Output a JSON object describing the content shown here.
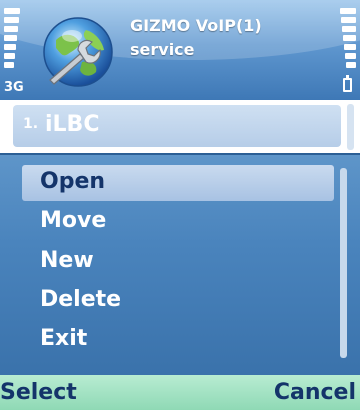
{
  "status_bar": {
    "network_label": "3G"
  },
  "app_header": {
    "title": "GIZMO VoIP(1)",
    "subtitle": "service",
    "icon": "globe-wrench-icon"
  },
  "list": {
    "items": [
      {
        "number": "1.",
        "label": "iLBC"
      }
    ]
  },
  "options_menu": {
    "items": [
      {
        "label": "Open",
        "selected": true
      },
      {
        "label": "Move",
        "selected": false
      },
      {
        "label": "New",
        "selected": false
      },
      {
        "label": "Delete",
        "selected": false
      },
      {
        "label": "Exit",
        "selected": false
      }
    ]
  },
  "softkeys": {
    "left": "Select",
    "right": "Cancel"
  },
  "colors": {
    "header_gradient_top": "#98c3ea",
    "menu_background": "#4a84bd",
    "selected_item": "#b8cfe9",
    "softkey_background": "#a3e2c3",
    "softkey_text": "#14346a"
  }
}
